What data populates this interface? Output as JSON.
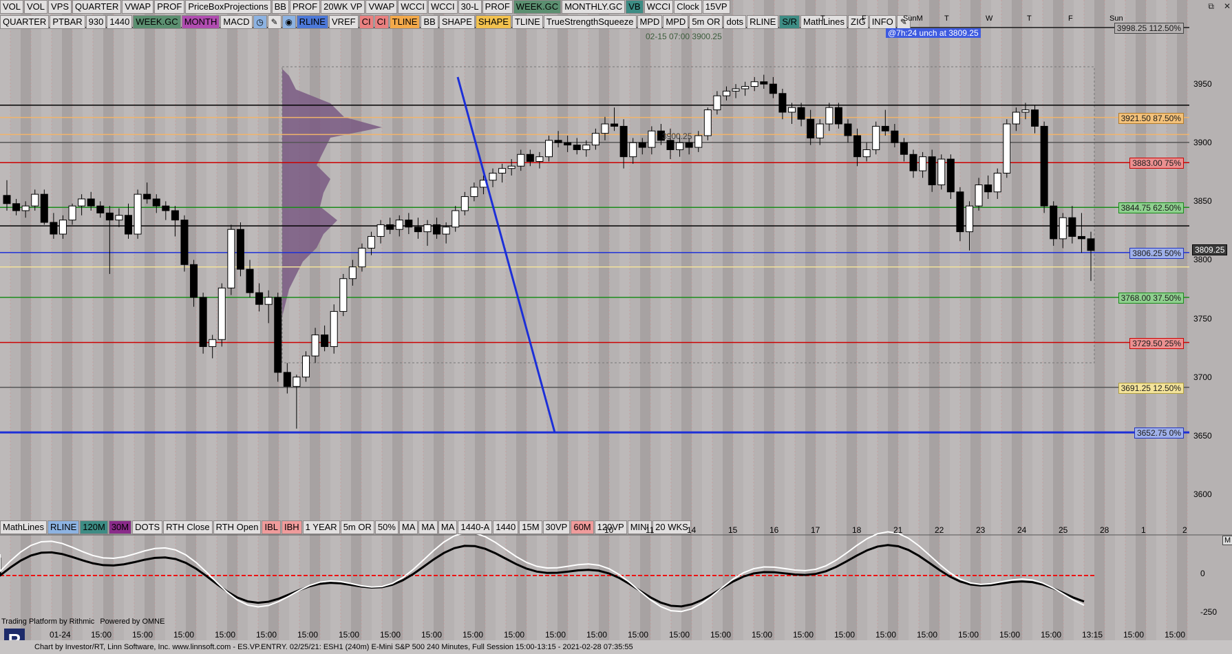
{
  "toolbar_top": [
    "VOL",
    "VOL",
    "VPS",
    "QUARTER",
    "VWAP",
    "PROF",
    "PriceBoxProjections",
    "BB",
    "PROF",
    "20WK VP",
    "VWAP",
    "WCCI",
    "WCCI",
    "30-L",
    "PROF",
    "WEEK.GC",
    "MONTHLY.GC",
    "VB",
    "WCCI",
    "Clock",
    "15VP"
  ],
  "toolbar_top_states": [
    "",
    "",
    "",
    "",
    "",
    "",
    "",
    "",
    "",
    "",
    "",
    "",
    "",
    "",
    "",
    "green",
    "",
    "teal",
    "",
    "",
    ""
  ],
  "toolbar_second": [
    "QUARTER",
    "PTBAR",
    "930",
    "1440",
    "WEEK.GC",
    "MONTH",
    "MACD",
    "◷",
    "✎",
    "◉",
    "RLINE",
    "VREF",
    "CI",
    "CI",
    "TLINE",
    "BB",
    "SHAPE",
    "SHAPE",
    "TLINE",
    "TrueStrengthSqueeze",
    "MPD",
    "MPD",
    "5m OR",
    "dots",
    "RLINE",
    "S/R",
    "MathLines",
    "ZIG",
    "INFO",
    "✎"
  ],
  "toolbar_second_states": [
    "",
    "",
    "",
    "",
    "green",
    "purple",
    "",
    "lblue",
    "",
    "lblue",
    "blue",
    "",
    "red",
    "red",
    "orange",
    "",
    "",
    "gold",
    "",
    "",
    "",
    "",
    "",
    "",
    "",
    "teal",
    "",
    "",
    "",
    ""
  ],
  "toolbar_bottom": [
    "MathLines",
    "RLINE",
    "120M",
    "30M",
    "DOTS",
    "RTH Close",
    "RTH Open",
    "IBL",
    "IBH",
    "1 YEAR",
    "5m OR",
    "50%",
    "MA",
    "MA",
    "MA",
    "1440-A",
    "1440",
    "15M",
    "30VP",
    "60M",
    "120VP",
    "MINI",
    "20 WKS"
  ],
  "toolbar_bottom_states": [
    "",
    "lblue",
    "teal",
    "dpurple",
    "",
    "",
    "",
    "salmon",
    "salmon",
    "",
    "",
    "",
    "",
    "",
    "",
    "",
    "",
    "",
    "",
    "salmon",
    "",
    "",
    ""
  ],
  "tooltip_time": "02-15 07:00",
  "tooltip_price": "3900.25",
  "unch_badge": "@7h:24  unch at 3809.25",
  "mid_label": "3900.25",
  "window_controls": [
    "⧉",
    "✕"
  ],
  "price_axis": {
    "ticks": [
      3950,
      3900,
      3850,
      3800,
      3750,
      3700,
      3650,
      3600
    ],
    "current": "3809.25"
  },
  "level_labels": [
    {
      "text": "3998.25 112.50%",
      "price": 3998.25,
      "color": "#1a1a1a",
      "bg": "#b6b2b2",
      "border": "#444"
    },
    {
      "text": "3921.50 87.50%",
      "price": 3921.5,
      "color": "#1a1a1a",
      "bg": "#f3c17a",
      "border": "#b07a2b"
    },
    {
      "text": "3883.00 75%",
      "price": 3883.0,
      "color": "#1a1a1a",
      "bg": "#ea9090",
      "border": "#c00"
    },
    {
      "text": "3844.75 62.50%",
      "price": 3844.75,
      "color": "#1a1a1a",
      "bg": "#8fd08f",
      "border": "#1a8c1a"
    },
    {
      "text": "3806.25 50%",
      "price": 3806.25,
      "color": "#1a1a1a",
      "bg": "#9fb0e8",
      "border": "#2233c0"
    },
    {
      "text": "3768.00 37.50%",
      "price": 3768.0,
      "color": "#1a1a1a",
      "bg": "#8fd08f",
      "border": "#1a8c1a"
    },
    {
      "text": "3729.50 25%",
      "price": 3729.5,
      "color": "#1a1a1a",
      "bg": "#ea9090",
      "border": "#c00"
    },
    {
      "text": "3691.25 12.50%",
      "price": 3691.25,
      "color": "#1a1a1a",
      "bg": "#f3e39a",
      "border": "#b0a040"
    },
    {
      "text": "3652.75 0%",
      "price": 3652.75,
      "color": "#1a1a1a",
      "bg": "#9fb0e8",
      "border": "#2233c0"
    }
  ],
  "top_day_labels": [
    "T",
    "F",
    "SunM",
    "T",
    "W",
    "T",
    "F",
    "Sun"
  ],
  "date_labels": [
    "10",
    "11",
    "14",
    "15",
    "16",
    "17",
    "18",
    "21",
    "22",
    "23",
    "24",
    "25",
    "28",
    "1",
    "2"
  ],
  "time_labels": [
    "01-24",
    "15:00",
    "15:00",
    "15:00",
    "15:00",
    "15:00",
    "15:00",
    "15:00",
    "15:00",
    "15:00",
    "15:00",
    "15:00",
    "15:00",
    "15:00",
    "15:00",
    "15:00",
    "15:00",
    "15:00",
    "15:00",
    "15:00",
    "15:00",
    "15:00",
    "15:00",
    "15:00",
    "15:00",
    "13:15",
    "15:00",
    "15:00"
  ],
  "indicator_axis": [
    "0",
    "-250"
  ],
  "indicator_button": "M",
  "rithmic_text": "Trading Platform by Rithmic",
  "omne_text": "Powered by OMNE",
  "logo_letter": "R",
  "footer_text": "Chart by Investor/RT, Linn Software, Inc. www.linnsoft.com - ES.VP.ENTRY.     02/25/21: ESH1 (240m) E-Mini S&P 500 240 Minutes, Full Session 15:00-13:15 - 2021-02-28 07:35:55",
  "colors": {
    "bull": "#ffffff",
    "bear": "#000000",
    "volume_profile": "#7a5a82",
    "rline": "#1c2fd8"
  },
  "chart_data": {
    "type": "candlestick",
    "symbol": "ESH1",
    "interval": "240m",
    "ylim": [
      3580,
      4010
    ],
    "candles": [
      [
        3855,
        3868,
        3842,
        3848
      ],
      [
        3848,
        3852,
        3838,
        3842
      ],
      [
        3842,
        3850,
        3836,
        3846
      ],
      [
        3846,
        3860,
        3842,
        3856
      ],
      [
        3856,
        3860,
        3830,
        3832
      ],
      [
        3832,
        3840,
        3818,
        3822
      ],
      [
        3822,
        3838,
        3818,
        3834
      ],
      [
        3834,
        3848,
        3830,
        3846
      ],
      [
        3846,
        3856,
        3838,
        3852
      ],
      [
        3852,
        3858,
        3842,
        3846
      ],
      [
        3846,
        3850,
        3836,
        3840
      ],
      [
        3840,
        3846,
        3788,
        3834
      ],
      [
        3834,
        3844,
        3828,
        3838
      ],
      [
        3838,
        3848,
        3818,
        3822
      ],
      [
        3822,
        3860,
        3818,
        3856
      ],
      [
        3856,
        3866,
        3848,
        3852
      ],
      [
        3852,
        3856,
        3840,
        3846
      ],
      [
        3846,
        3850,
        3834,
        3842
      ],
      [
        3842,
        3846,
        3820,
        3834
      ],
      [
        3834,
        3838,
        3790,
        3796
      ],
      [
        3796,
        3800,
        3760,
        3768
      ],
      [
        3768,
        3772,
        3720,
        3726
      ],
      [
        3726,
        3736,
        3716,
        3732
      ],
      [
        3732,
        3780,
        3726,
        3776
      ],
      [
        3776,
        3830,
        3770,
        3826
      ],
      [
        3826,
        3832,
        3786,
        3792
      ],
      [
        3792,
        3800,
        3768,
        3772
      ],
      [
        3772,
        3780,
        3756,
        3762
      ],
      [
        3762,
        3774,
        3746,
        3768
      ],
      [
        3768,
        3772,
        3696,
        3704
      ],
      [
        3704,
        3712,
        3686,
        3692
      ],
      [
        3692,
        3702,
        3656,
        3700
      ],
      [
        3700,
        3722,
        3696,
        3718
      ],
      [
        3718,
        3742,
        3712,
        3736
      ],
      [
        3736,
        3744,
        3722,
        3726
      ],
      [
        3726,
        3762,
        3720,
        3756
      ],
      [
        3756,
        3788,
        3752,
        3784
      ],
      [
        3784,
        3800,
        3778,
        3794
      ],
      [
        3794,
        3814,
        3790,
        3810
      ],
      [
        3810,
        3824,
        3804,
        3820
      ],
      [
        3820,
        3834,
        3814,
        3830
      ],
      [
        3830,
        3836,
        3822,
        3826
      ],
      [
        3826,
        3838,
        3820,
        3834
      ],
      [
        3834,
        3840,
        3822,
        3828
      ],
      [
        3828,
        3836,
        3818,
        3824
      ],
      [
        3824,
        3834,
        3812,
        3830
      ],
      [
        3830,
        3836,
        3818,
        3822
      ],
      [
        3822,
        3832,
        3814,
        3828
      ],
      [
        3828,
        3846,
        3824,
        3842
      ],
      [
        3842,
        3858,
        3838,
        3854
      ],
      [
        3854,
        3866,
        3850,
        3862
      ],
      [
        3862,
        3872,
        3856,
        3868
      ],
      [
        3868,
        3878,
        3862,
        3874
      ],
      [
        3874,
        3882,
        3866,
        3878
      ],
      [
        3878,
        3886,
        3872,
        3880
      ],
      [
        3880,
        3894,
        3876,
        3890
      ],
      [
        3890,
        3894,
        3880,
        3884
      ],
      [
        3884,
        3892,
        3878,
        3888
      ],
      [
        3888,
        3906,
        3884,
        3902
      ],
      [
        3902,
        3910,
        3896,
        3900
      ],
      [
        3900,
        3906,
        3892,
        3898
      ],
      [
        3898,
        3904,
        3890,
        3894
      ],
      [
        3894,
        3902,
        3888,
        3898
      ],
      [
        3898,
        3912,
        3894,
        3908
      ],
      [
        3908,
        3922,
        3902,
        3916
      ],
      [
        3916,
        3930,
        3910,
        3914
      ],
      [
        3914,
        3920,
        3878,
        3888
      ],
      [
        3888,
        3904,
        3882,
        3900
      ],
      [
        3900,
        3904,
        3890,
        3896
      ],
      [
        3896,
        3914,
        3890,
        3910
      ],
      [
        3910,
        3916,
        3898,
        3902
      ],
      [
        3902,
        3912,
        3886,
        3894
      ],
      [
        3894,
        3906,
        3888,
        3900
      ],
      [
        3900,
        3904,
        3890,
        3896
      ],
      [
        3896,
        3910,
        3892,
        3906
      ],
      [
        3906,
        3930,
        3902,
        3928
      ],
      [
        3928,
        3944,
        3924,
        3940
      ],
      [
        3940,
        3948,
        3936,
        3944
      ],
      [
        3944,
        3950,
        3938,
        3946
      ],
      [
        3946,
        3952,
        3940,
        3948
      ],
      [
        3948,
        3956,
        3944,
        3952
      ],
      [
        3952,
        3958,
        3946,
        3950
      ],
      [
        3950,
        3956,
        3938,
        3942
      ],
      [
        3942,
        3946,
        3920,
        3926
      ],
      [
        3926,
        3934,
        3916,
        3930
      ],
      [
        3930,
        3934,
        3914,
        3920
      ],
      [
        3920,
        3928,
        3898,
        3904
      ],
      [
        3904,
        3920,
        3898,
        3916
      ],
      [
        3916,
        3934,
        3910,
        3930
      ],
      [
        3930,
        3934,
        3912,
        3916
      ],
      [
        3916,
        3920,
        3900,
        3906
      ],
      [
        3906,
        3912,
        3880,
        3888
      ],
      [
        3888,
        3900,
        3884,
        3894
      ],
      [
        3894,
        3918,
        3890,
        3914
      ],
      [
        3914,
        3928,
        3906,
        3910
      ],
      [
        3910,
        3916,
        3896,
        3900
      ],
      [
        3900,
        3904,
        3884,
        3890
      ],
      [
        3890,
        3894,
        3870,
        3876
      ],
      [
        3876,
        3892,
        3870,
        3888
      ],
      [
        3888,
        3894,
        3858,
        3864
      ],
      [
        3864,
        3890,
        3860,
        3886
      ],
      [
        3886,
        3890,
        3852,
        3858
      ],
      [
        3858,
        3862,
        3816,
        3824
      ],
      [
        3824,
        3850,
        3808,
        3846
      ],
      [
        3846,
        3870,
        3842,
        3864
      ],
      [
        3864,
        3872,
        3852,
        3858
      ],
      [
        3858,
        3878,
        3852,
        3874
      ],
      [
        3874,
        3920,
        3870,
        3916
      ],
      [
        3916,
        3930,
        3910,
        3926
      ],
      [
        3926,
        3934,
        3920,
        3928
      ],
      [
        3928,
        3932,
        3908,
        3914
      ],
      [
        3914,
        3918,
        3840,
        3846
      ],
      [
        3846,
        3850,
        3812,
        3818
      ],
      [
        3818,
        3840,
        3810,
        3836
      ],
      [
        3836,
        3846,
        3814,
        3820
      ],
      [
        3820,
        3840,
        3806,
        3818
      ],
      [
        3818,
        3824,
        3782,
        3808
      ]
    ],
    "horizontal_levels": [
      {
        "price": 3998.25,
        "color": "#1a1a1a"
      },
      {
        "price": 3932,
        "color": "#000000"
      },
      {
        "price": 3921.5,
        "color": "#f2b46a"
      },
      {
        "price": 3907,
        "color": "#f2b46a"
      },
      {
        "price": 3900.25,
        "color": "#555555"
      },
      {
        "price": 3883.0,
        "color": "#cc0000"
      },
      {
        "price": 3844.75,
        "color": "#1a8c1a"
      },
      {
        "price": 3829,
        "color": "#000000"
      },
      {
        "price": 3806.25,
        "color": "#1c2fd8"
      },
      {
        "price": 3794,
        "color": "#f3e39a"
      },
      {
        "price": 3768.0,
        "color": "#1a8c1a"
      },
      {
        "price": 3729.5,
        "color": "#cc0000"
      },
      {
        "price": 3691.25,
        "color": "#555555"
      },
      {
        "price": 3652.75,
        "color": "#1c2fd8"
      }
    ],
    "trendline": {
      "from": [
        3956,
        3956
      ],
      "to": [
        3652.75,
        3652.75
      ]
    }
  }
}
